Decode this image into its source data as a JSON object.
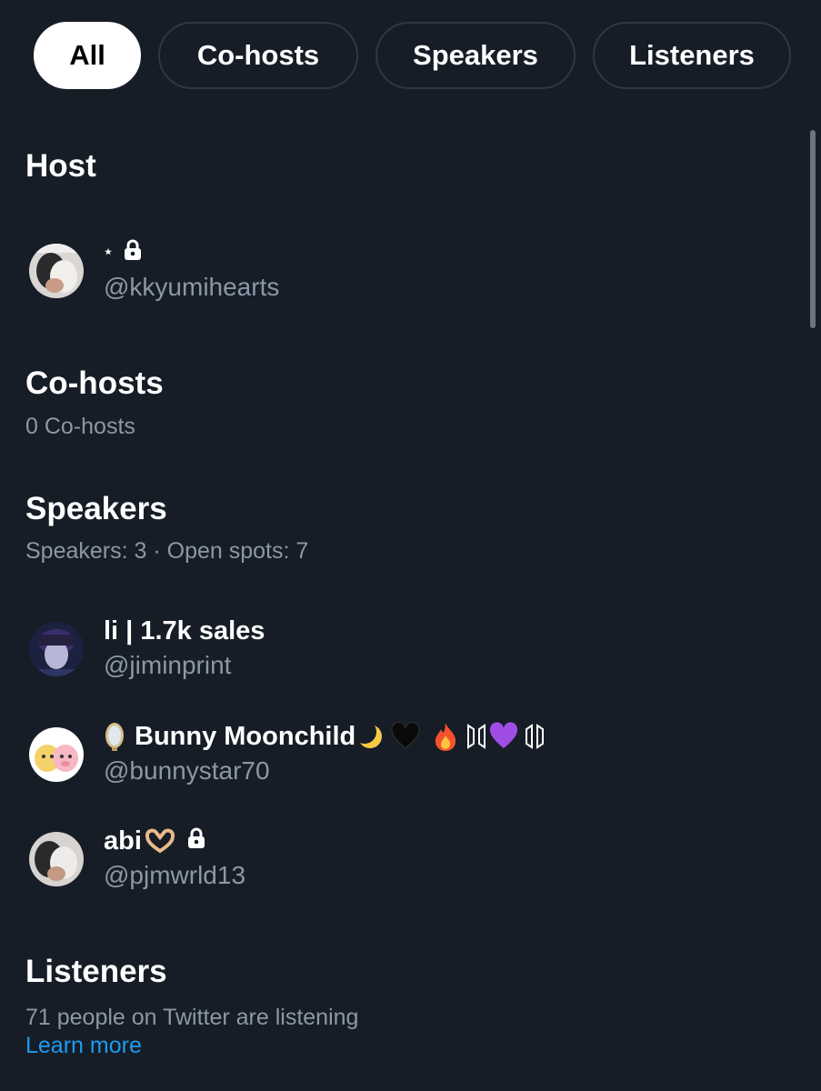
{
  "tabs": [
    {
      "label": "All",
      "active": true
    },
    {
      "label": "Co-hosts",
      "active": false
    },
    {
      "label": "Speakers",
      "active": false
    },
    {
      "label": "Listeners",
      "active": false
    }
  ],
  "host": {
    "title": "Host",
    "user": {
      "display_name": "⋆",
      "handle": "@kkyumihearts",
      "protected": true
    }
  },
  "cohosts": {
    "title": "Co-hosts",
    "subtitle": "0 Co-hosts"
  },
  "speakers": {
    "title": "Speakers",
    "subtitle": "Speakers: 3 · Open spots: 7",
    "users": [
      {
        "display_name": "li | 1.7k sales",
        "handle": "@jiminprint"
      },
      {
        "display_name": "Bunny Moonchild",
        "handle": "@bunnystar70"
      },
      {
        "display_name": "abi",
        "handle": "@pjmwrld13",
        "protected": true
      }
    ]
  },
  "listeners": {
    "title": "Listeners",
    "subtitle": "71 people on Twitter are listening",
    "learn_more": "Learn more"
  },
  "colors": {
    "background": "#161d27",
    "secondary_text": "#8b98a5",
    "link": "#1d9bf0",
    "tab_border": "#2f3742"
  }
}
